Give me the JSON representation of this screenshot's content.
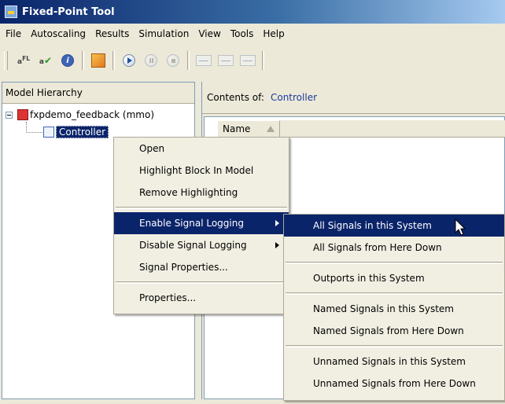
{
  "window": {
    "title": "Fixed-Point Tool"
  },
  "menubar": {
    "items": [
      "File",
      "Autoscaling",
      "Results",
      "Simulation",
      "View",
      "Tools",
      "Help"
    ]
  },
  "tree": {
    "header": "Model Hierarchy",
    "root_label": "fxpdemo_feedback (mmo)",
    "child_label": "Controller"
  },
  "contents": {
    "label": "Contents of:",
    "value": "Controller",
    "column_name": "Name"
  },
  "context_menu": {
    "items": [
      "Open",
      "Highlight Block In Model",
      "Remove Highlighting",
      "Enable Signal Logging",
      "Disable Signal Logging",
      "Signal Properties...",
      "Properties..."
    ]
  },
  "submenu": {
    "items": [
      "All Signals in this System",
      "All Signals from Here Down",
      "Outports in this System",
      "Named Signals in this System",
      "Named Signals from Here Down",
      "Unnamed Signals in this System",
      "Unnamed Signals from Here Down"
    ]
  },
  "colors": {
    "selection": "#0a246a",
    "menu_bg": "#f1efe2",
    "link": "#1a3a9c"
  },
  "toolbar_icons": [
    "fl-scaling-icon",
    "fl-check-icon",
    "info-icon",
    "model-explorer-icon",
    "play-icon",
    "pause-icon",
    "stop-icon",
    "plot-icon",
    "histogram-icon",
    "compare-icon"
  ]
}
